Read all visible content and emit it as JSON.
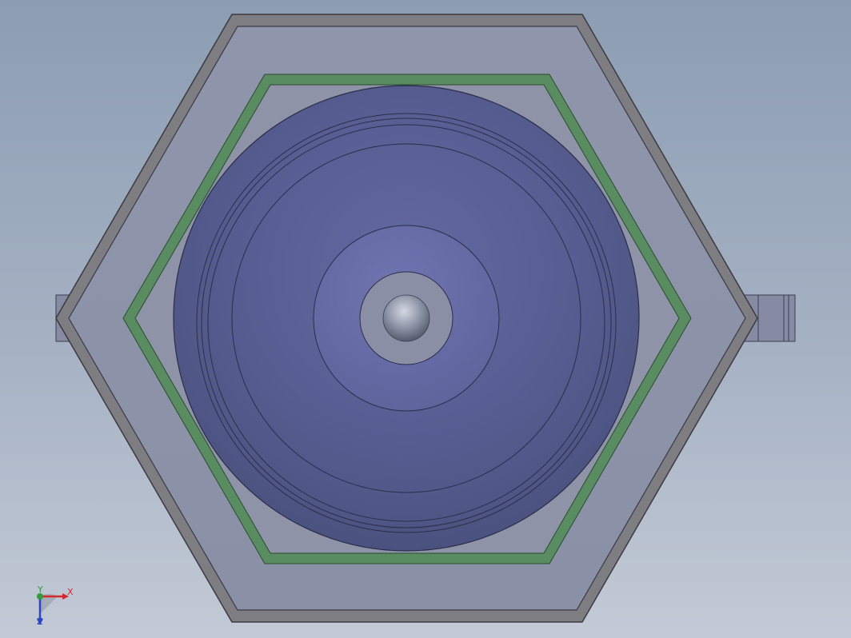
{
  "view": {
    "type": "cad-model-viewport",
    "orientation_triad": {
      "x_label": "X",
      "y_label": "Y",
      "z_label": "Z",
      "colors": {
        "x": "#d12b2b",
        "y": "#2f9c3f",
        "z": "#2b45c8"
      }
    },
    "colors": {
      "background_top": "#8c9db2",
      "background_bottom": "#c3cad6",
      "hex_outer_rim": "#7d7d82",
      "hex_body": "#8e93a8",
      "gasket_ring": "#5a8c62",
      "disk": "#5b6296",
      "hub": "#6b6fa8",
      "center_boss": "#8a8fa6",
      "ball": "#9aa1b4"
    }
  }
}
